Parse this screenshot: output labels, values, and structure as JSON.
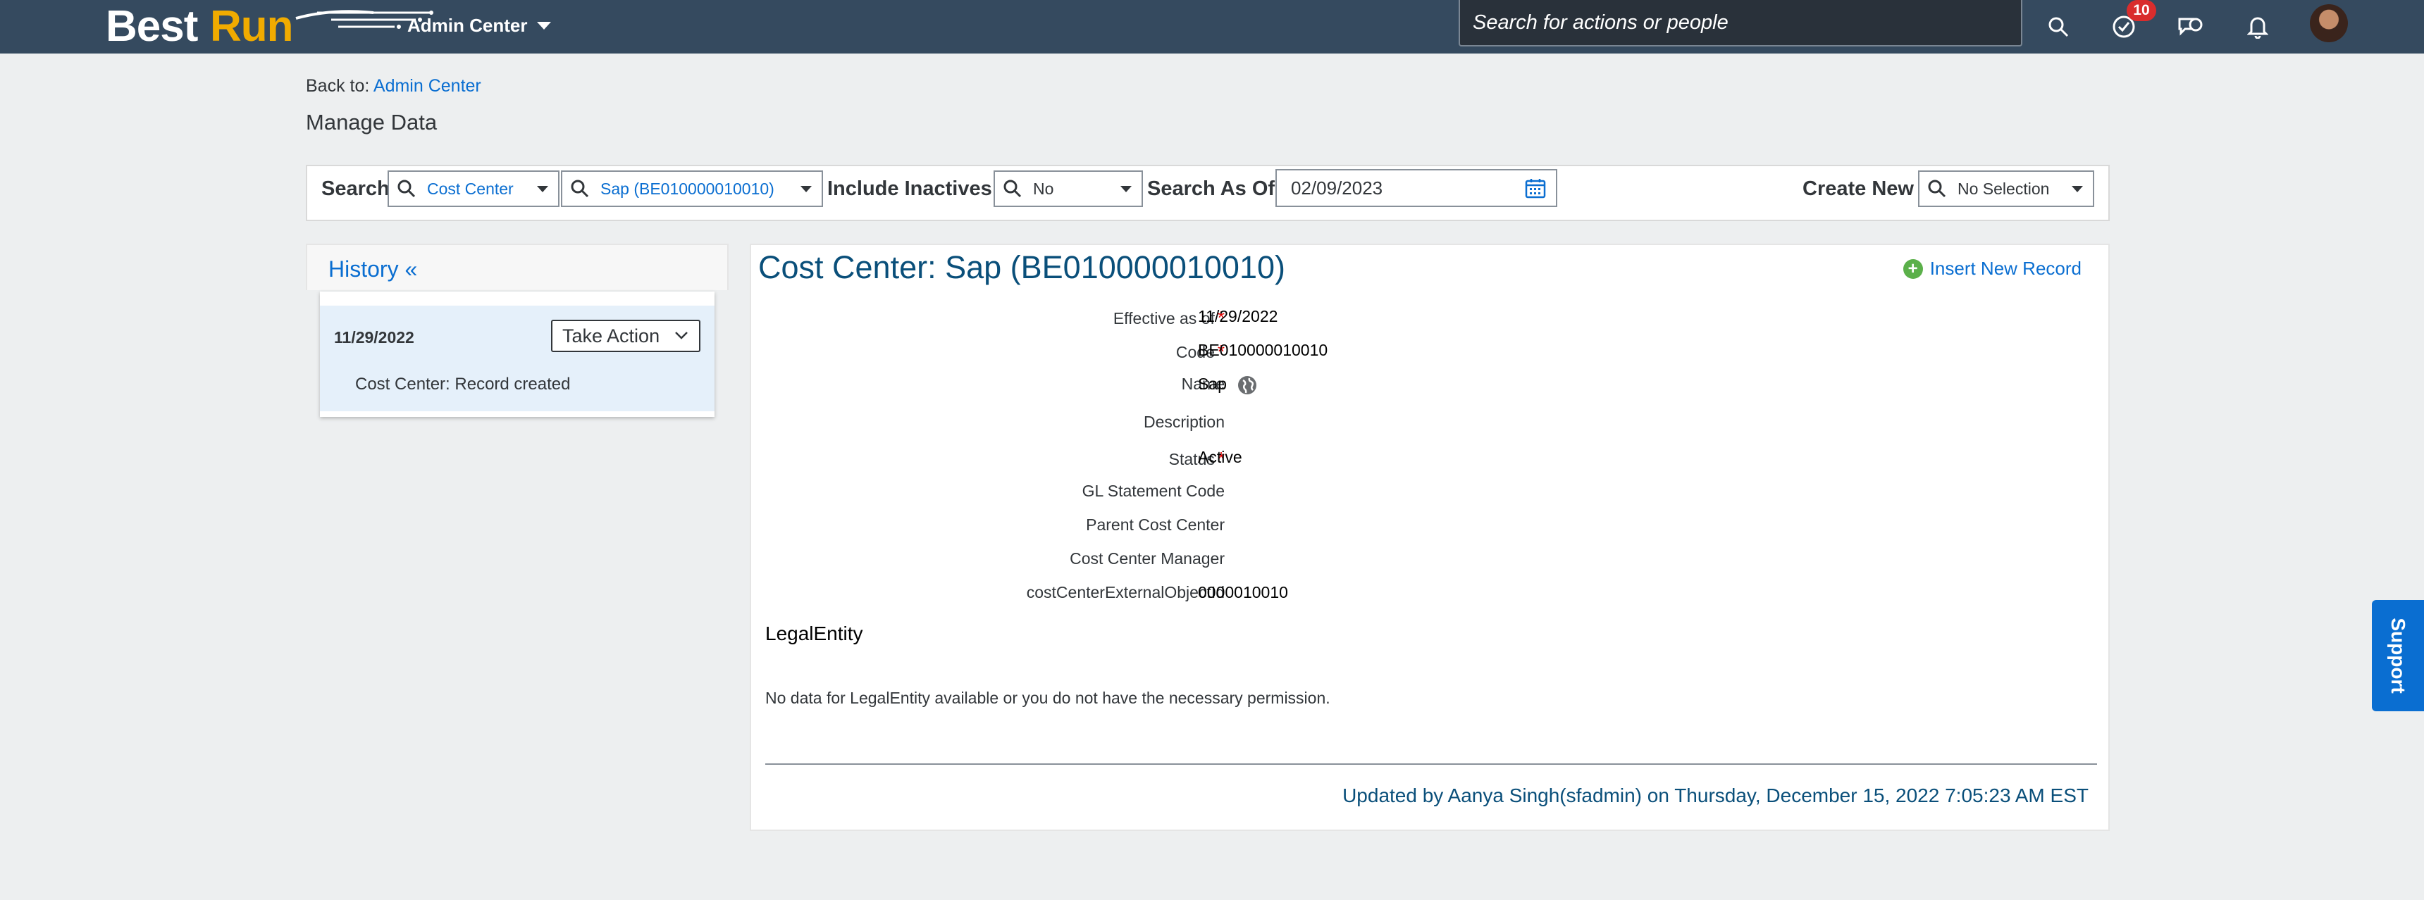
{
  "shell": {
    "logo_best": "Best",
    "logo_run": "Run",
    "admin_menu": "Admin Center",
    "search_placeholder": "Search for actions or people",
    "notification_count": "10"
  },
  "breadcrumb": {
    "prefix": "Back to:",
    "link": "Admin Center"
  },
  "page_title": "Manage Data",
  "toolbar": {
    "search_label": "Search",
    "object_type": "Cost Center",
    "object_value": "Sap (BE010000010010)",
    "include_inactives_label": "Include Inactives:",
    "include_inactives_value": "No",
    "search_as_of_label": "Search As Of:",
    "search_as_of_value": "02/09/2023",
    "create_new_label": "Create New",
    "create_new_value": "No Selection"
  },
  "history": {
    "title": "History «",
    "items": [
      {
        "date": "11/29/2022",
        "action_label": "Take Action",
        "description": "Cost Center: Record created"
      }
    ]
  },
  "record": {
    "title": "Cost Center: Sap (BE010000010010)",
    "insert_label": "Insert New Record",
    "fields": [
      {
        "label": "Effective as of",
        "required": true,
        "value": "11/29/2022"
      },
      {
        "label": "Code",
        "required": true,
        "value": "BE010000010010"
      },
      {
        "label": "Name",
        "required": false,
        "value": "Sap"
      },
      {
        "label": "Description",
        "required": false,
        "value": ""
      },
      {
        "label": "Status",
        "required": true,
        "value": "Active"
      },
      {
        "label": "GL Statement Code",
        "required": false,
        "value": ""
      },
      {
        "label": "Parent Cost Center",
        "required": false,
        "value": ""
      },
      {
        "label": "Cost Center Manager",
        "required": false,
        "value": ""
      },
      {
        "label": "costCenterExternalObjectId",
        "required": false,
        "value": "0000010010"
      }
    ],
    "legal_entity_title": "LegalEntity",
    "legal_entity_message": "No data for LegalEntity available or you do not have the necessary permission.",
    "updated_text": "Updated by Aanya Singh(sfadmin) on Thursday, December 15, 2022 7:05:23 AM EST"
  },
  "support_label": "Support",
  "colors": {
    "shell": "#354a5f",
    "link": "#0a6ed1",
    "title": "#0a4f7a",
    "badge": "#d92d2d",
    "required": "#e00000"
  }
}
